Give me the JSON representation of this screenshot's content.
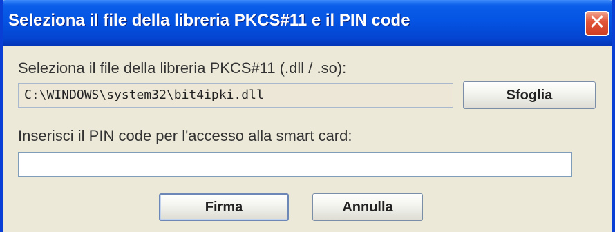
{
  "window": {
    "title": "Seleziona il file della libreria PKCS#11 e il PIN code",
    "close_glyph": "✕"
  },
  "library": {
    "label": "Seleziona il file della libreria PKCS#11 (.dll / .so):",
    "path_value": "C:\\WINDOWS\\system32\\bit4ipki.dll",
    "browse_label": "Sfoglia"
  },
  "pin": {
    "label": "Inserisci il PIN code per l'accesso alla smart card:",
    "value": ""
  },
  "actions": {
    "sign_label": "Firma",
    "cancel_label": "Annulla"
  },
  "colors": {
    "titlebar": "#0554e3",
    "window_bg": "#ece9d8",
    "close_button": "#e2563a"
  }
}
